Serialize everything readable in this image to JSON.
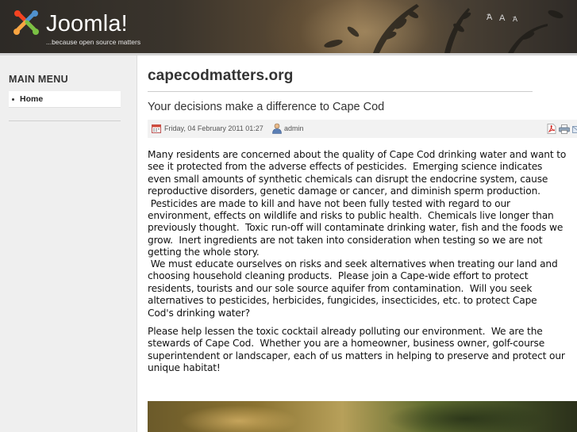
{
  "header": {
    "logo_name": "Joomla!",
    "tagline": "...because open source matters",
    "font_controls": {
      "increase": "A",
      "increase_sup": "+",
      "reset": "A",
      "decrease": "A",
      "decrease_sup": "-"
    }
  },
  "sidebar": {
    "menu_title": "MAIN MENU",
    "items": [
      {
        "label": "Home"
      }
    ]
  },
  "main": {
    "site_title": "capecodmatters.org",
    "article": {
      "title": "Your decisions make a difference to Cape Cod",
      "date": "Friday, 04 February 2011 01:27",
      "author": "admin",
      "icons": [
        "calendar-icon",
        "user-icon",
        "pdf-icon",
        "print-icon",
        "email-icon"
      ],
      "paragraphs": [
        "Many residents are concerned about the quality of Cape Cod drinking water and want to\nsee it protected from the adverse effects of pesticides.  Emerging science indicates\neven small amounts of synthetic chemicals can disrupt the endocrine system, cause\nreproductive disorders, genetic damage or cancer, and diminish sperm production.\n Pesticides are made to kill and have not been fully tested with regard to our\nenvironment, effects on wildlife and risks to public health.  Chemicals live longer than\npreviously thought.  Toxic run-off will contaminate drinking water, fish and the foods we\ngrow.  Inert ingredients are not taken into consideration when testing so we are not\ngetting the whole story.",
        " We must educate ourselves on risks and seek alternatives when treating our land and\nchoosing household cleaning products.  Please join a Cape-wide effort to protect\nresidents, tourists and our sole source aquifer from contamination.  Will you seek\nalternatives to pesticides, herbicides, fungicides, insecticides, etc. to protect Cape\nCod's drinking water?",
        "Please help lessen the toxic cocktail already polluting our environment.  We are the\nstewards of Cape Cod.  Whether you are a homeowner, business owner, golf-course\nsuperintendent or landscaper, each of us matters in helping to preserve and protect our\nunique habitat!"
      ]
    }
  },
  "colors": {
    "header_dark": "#2d2a26",
    "sidebar_bg": "#efefef",
    "text": "#333333",
    "meta_bg": "#f2f2f2"
  }
}
